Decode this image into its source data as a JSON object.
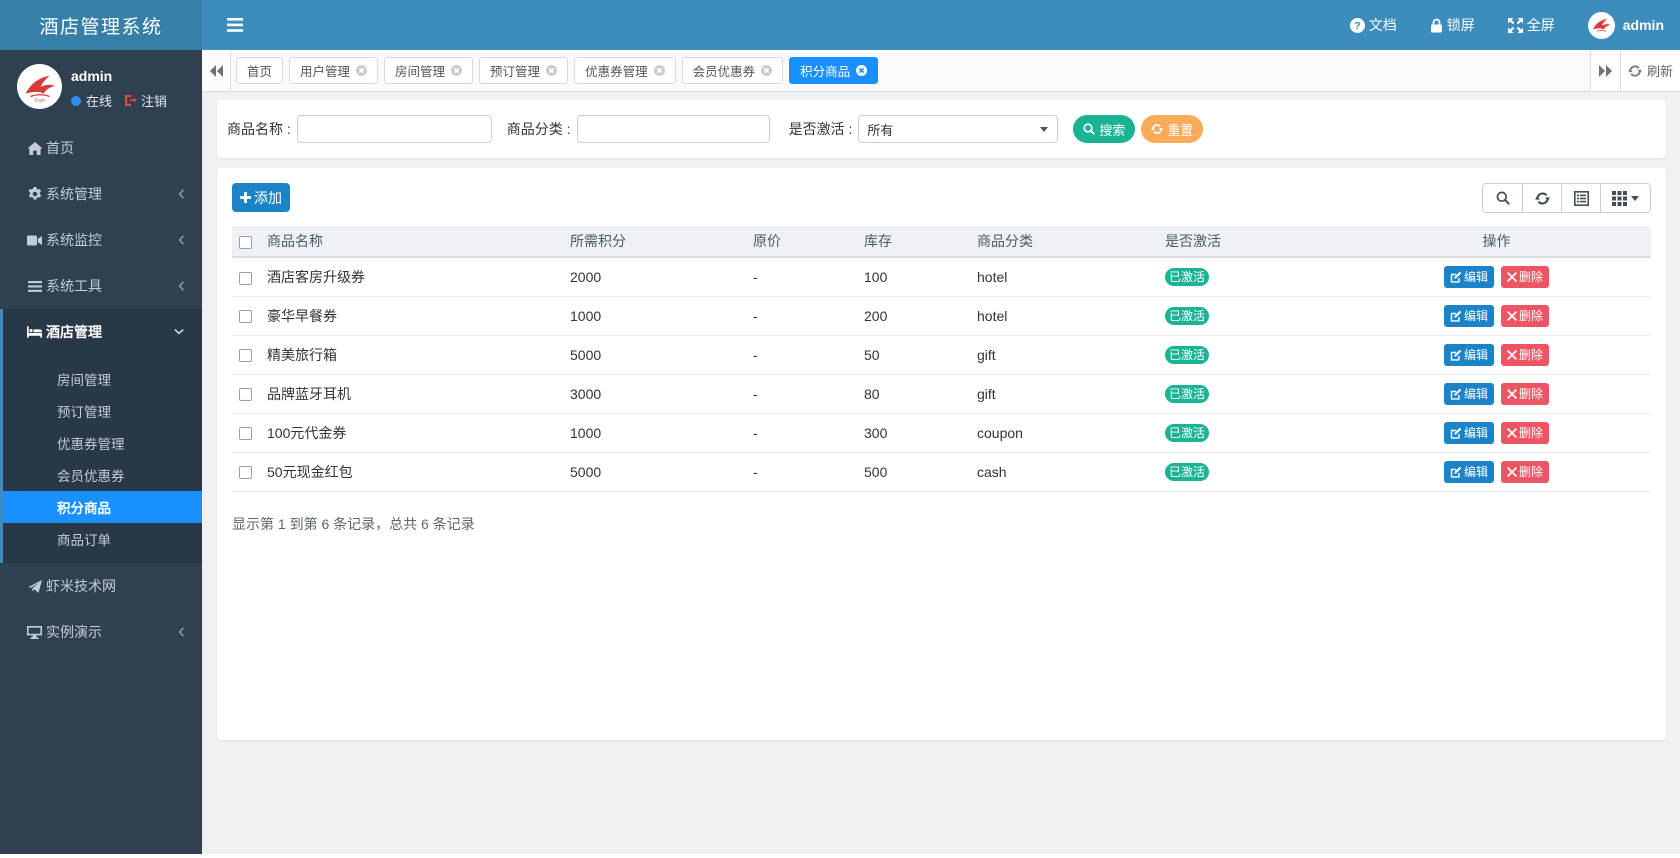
{
  "brand": {
    "title": "酒店管理系统"
  },
  "navbar": {
    "doc_label": "文档",
    "lock_label": "锁屏",
    "fullscreen_label": "全屏",
    "user_name": "admin"
  },
  "sidebar": {
    "user": {
      "name": "admin",
      "status": "在线",
      "logout": "注销"
    },
    "menu": [
      {
        "label": "首页",
        "icon": "home-icon"
      },
      {
        "label": "系统管理",
        "icon": "gear-icon"
      },
      {
        "label": "系统监控",
        "icon": "camera-icon"
      },
      {
        "label": "系统工具",
        "icon": "bars-icon"
      },
      {
        "label": "酒店管理",
        "icon": "bed-icon",
        "expanded": true,
        "children": [
          {
            "label": "房间管理"
          },
          {
            "label": "预订管理"
          },
          {
            "label": "优惠券管理"
          },
          {
            "label": "会员优惠券"
          },
          {
            "label": "积分商品",
            "active": true
          },
          {
            "label": "商品订单"
          }
        ]
      },
      {
        "label": "虾米技术网",
        "icon": "send-icon"
      },
      {
        "label": "实例演示",
        "icon": "desktop-icon"
      }
    ]
  },
  "tabs": {
    "refresh_label": "刷新",
    "items": [
      {
        "label": "首页",
        "closable": false,
        "active": false
      },
      {
        "label": "用户管理",
        "closable": true,
        "active": false
      },
      {
        "label": "房间管理",
        "closable": true,
        "active": false
      },
      {
        "label": "预订管理",
        "closable": true,
        "active": false
      },
      {
        "label": "优惠券管理",
        "closable": true,
        "active": false
      },
      {
        "label": "会员优惠券",
        "closable": true,
        "active": false
      },
      {
        "label": "积分商品",
        "closable": true,
        "active": true
      }
    ]
  },
  "filters": {
    "name_label": "商品名称 :",
    "category_label": "商品分类 :",
    "active_label": "是否激活 :",
    "active_value": "所有",
    "search_label": "搜索",
    "reset_label": "重置"
  },
  "toolbar": {
    "add_label": "添加"
  },
  "table": {
    "columns": [
      "商品名称",
      "所需积分",
      "原价",
      "库存",
      "商品分类",
      "是否激活",
      "操作"
    ],
    "edit_label": "编辑",
    "delete_label": "删除",
    "status_active": "已激活",
    "rows": [
      {
        "name": "酒店客房升级券",
        "points": "2000",
        "price": "-",
        "stock": "100",
        "category": "hotel",
        "status": "已激活"
      },
      {
        "name": "豪华早餐券",
        "points": "1000",
        "price": "-",
        "stock": "200",
        "category": "hotel",
        "status": "已激活"
      },
      {
        "name": "精美旅行箱",
        "points": "5000",
        "price": "-",
        "stock": "50",
        "category": "gift",
        "status": "已激活"
      },
      {
        "name": "品牌蓝牙耳机",
        "points": "3000",
        "price": "-",
        "stock": "80",
        "category": "gift",
        "status": "已激活"
      },
      {
        "name": "100元代金券",
        "points": "1000",
        "price": "-",
        "stock": "300",
        "category": "coupon",
        "status": "已激活"
      },
      {
        "name": "50元现金红包",
        "points": "5000",
        "price": "-",
        "stock": "500",
        "category": "cash",
        "status": "已激活"
      }
    ],
    "summary": "显示第 1 到第 6 条记录，总共 6 条记录"
  }
}
